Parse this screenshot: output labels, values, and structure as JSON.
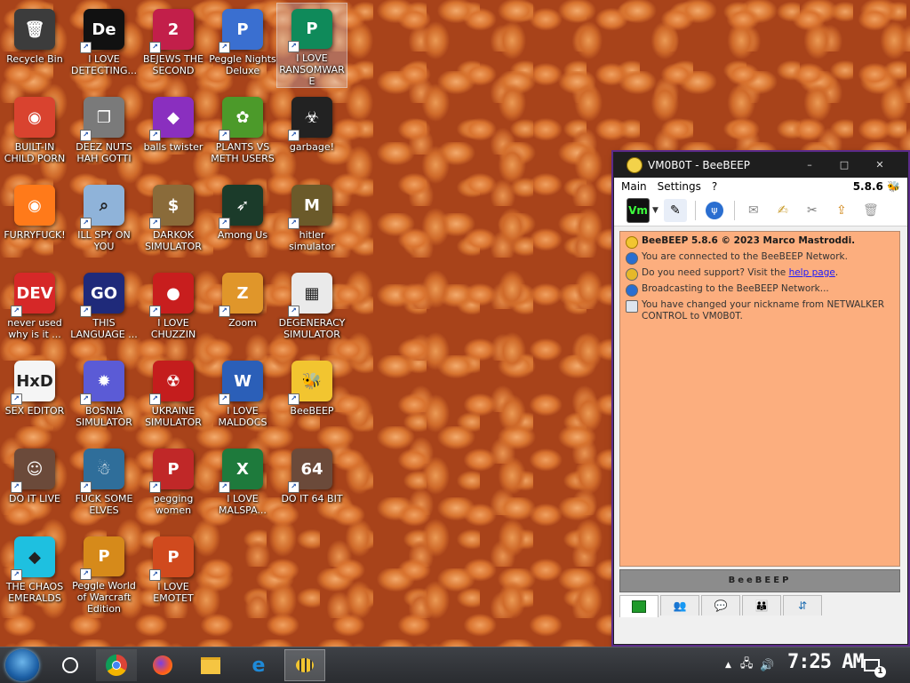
{
  "desktop": {
    "icons": [
      {
        "label": "Recycle Bin",
        "glyph": "🗑",
        "color": "#3c3c3c",
        "shortcut": false
      },
      {
        "label": "I LOVE DETECTING...",
        "glyph": "De",
        "color": "#111111",
        "shortcut": true
      },
      {
        "label": "BEJEWS THE SECOND",
        "glyph": "2",
        "color": "#c21f4a",
        "shortcut": true
      },
      {
        "label": "Peggle Nights Deluxe",
        "glyph": "P",
        "color": "#3a6fd0",
        "shortcut": true
      },
      {
        "label": "I LOVE RANSOMWARE",
        "glyph": "P",
        "color": "#0f8a5a",
        "shortcut": true
      },
      {
        "label": "BUILT-IN CHILD PORN",
        "glyph": "◉",
        "color": "#d9432f",
        "shortcut": false
      },
      {
        "label": "DEEZ NUTS HAH GOTTI",
        "glyph": "❐",
        "color": "#7a7a7a",
        "shortcut": true
      },
      {
        "label": "balls twister",
        "glyph": "◆",
        "color": "#8a2fbf",
        "shortcut": true
      },
      {
        "label": "PLANTS VS METH USERS",
        "glyph": "✿",
        "color": "#4c9a2a",
        "shortcut": true
      },
      {
        "label": "garbage!",
        "glyph": "☣",
        "color": "#222222",
        "shortcut": true
      },
      {
        "label": "FURRYFUCK!",
        "glyph": "◉",
        "color": "#ff7a1a",
        "shortcut": false
      },
      {
        "label": "ILL SPY ON YOU",
        "glyph": "⌕",
        "color": "#8fb3d9",
        "shortcut": true
      },
      {
        "label": "DARKOK SIMULATOR",
        "glyph": "$",
        "color": "#8a6b3a",
        "shortcut": true
      },
      {
        "label": "Among Us",
        "glyph": "➶",
        "color": "#1b3b2a",
        "shortcut": true
      },
      {
        "label": "hitler simulator",
        "glyph": "M",
        "color": "#6b5a2a",
        "shortcut": true
      },
      {
        "label": "never used why is it ...",
        "glyph": "DEV",
        "color": "#d62828",
        "shortcut": true
      },
      {
        "label": "THIS LANGUAGE ...",
        "glyph": "GO",
        "color": "#1f2a7a",
        "shortcut": true
      },
      {
        "label": "I LOVE CHUZZIN",
        "glyph": "●",
        "color": "#c81e1e",
        "shortcut": true
      },
      {
        "label": "Zoom",
        "glyph": "Z",
        "color": "#e0962a",
        "shortcut": true
      },
      {
        "label": "DEGENERACY SIMULATOR",
        "glyph": "▦",
        "color": "#eaeaea",
        "shortcut": true
      },
      {
        "label": "SEX EDITOR",
        "glyph": "HxD",
        "color": "#f5f5f5",
        "shortcut": true
      },
      {
        "label": "BOSNIA SIMULATOR",
        "glyph": "✹",
        "color": "#5b5bd6",
        "shortcut": true
      },
      {
        "label": "UKRAINE SIMULATOR",
        "glyph": "☢",
        "color": "#c41d1d",
        "shortcut": true
      },
      {
        "label": "I LOVE MALDOCS",
        "glyph": "W",
        "color": "#2b5fb8",
        "shortcut": true
      },
      {
        "label": "BeeBEEP",
        "glyph": "🐝",
        "color": "#f2c530",
        "shortcut": true
      },
      {
        "label": "DO IT LIVE",
        "glyph": "☺",
        "color": "#6b4a3a",
        "shortcut": true
      },
      {
        "label": "FUCK SOME ELVES",
        "glyph": "☃",
        "color": "#2f6e9a",
        "shortcut": true
      },
      {
        "label": "pegging women",
        "glyph": "P",
        "color": "#c02828",
        "shortcut": true
      },
      {
        "label": "I LOVE MALSPA...",
        "glyph": "X",
        "color": "#1e7a3c",
        "shortcut": true
      },
      {
        "label": "DO IT 64 BIT",
        "glyph": "64",
        "color": "#6b4a3a",
        "shortcut": true
      },
      {
        "label": "THE CHAOS EMERALDS",
        "glyph": "◆",
        "color": "#1ec0e0",
        "shortcut": true
      },
      {
        "label": "Peggle World of Warcraft Edition",
        "glyph": "P",
        "color": "#d68a1a",
        "shortcut": true
      },
      {
        "label": "I LOVE EMOTET",
        "glyph": "P",
        "color": "#d04a1e",
        "shortcut": true
      }
    ]
  },
  "beebeep": {
    "title": "VM0B0T - BeeBEEP",
    "controls": {
      "minimize": "–",
      "maximize": "□",
      "close": "✕"
    },
    "menu": [
      "Main",
      "Settings",
      "?"
    ],
    "version": "5.8.6",
    "toolbar": {
      "status_label": "Vm",
      "buttons": [
        "edit-profile",
        "network",
        "mail",
        "compose",
        "tools",
        "share",
        "trash"
      ]
    },
    "messages": [
      {
        "icon": "bee",
        "bold": "BeeBEEP 5.8.6 © 2023 Marco Mastroddi.",
        "text": ""
      },
      {
        "icon": "connected",
        "bold": "",
        "text": "You are connected to the BeeBEEP Network."
      },
      {
        "icon": "support",
        "bold": "",
        "text": "Do you need support? Visit the ",
        "link": "help page",
        "after": "."
      },
      {
        "icon": "broadcast",
        "bold": "",
        "text": "Broadcasting to the BeeBEEP Network..."
      },
      {
        "icon": "profile",
        "bold": "",
        "text": "You have changed your nickname from NETWALKER CONTROL to VM0B0T."
      }
    ],
    "logo_text": "BeeBEEP",
    "tabs": [
      "chat",
      "users",
      "messages",
      "groups",
      "files"
    ],
    "chat_bg": "#fcae7e"
  },
  "taskbar": {
    "pinned": [
      "cortana",
      "chrome",
      "firefox",
      "file-explorer",
      "edge",
      "beebeep"
    ],
    "clock": "7:25 AM",
    "notification_count": "1",
    "tray_arrow": "▲"
  }
}
